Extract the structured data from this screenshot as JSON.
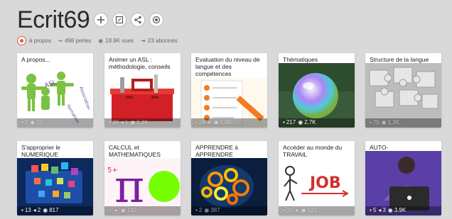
{
  "page": {
    "title": "Ecrit69",
    "buttons": [
      {
        "icon": "plus-icon"
      },
      {
        "icon": "edit-icon"
      },
      {
        "icon": "share-icon"
      },
      {
        "icon": "follow-icon"
      }
    ]
  },
  "stats": {
    "about": "à propos",
    "pearls": "498 perles",
    "views": "18.9K vues",
    "subscribers": "23 abonnés"
  },
  "cards": [
    {
      "title": "A propos...",
      "count": "2",
      "views": "37",
      "faint": true
    },
    {
      "title": "Animer un ASL : méthodologie, conseils",
      "count": "38",
      "likes": "1",
      "views": "1.3K",
      "faint": true
    },
    {
      "title": "Evaluation du niveau de langue et des compétences",
      "count": "26",
      "likes": "",
      "views": "1.3K",
      "faint": true
    },
    {
      "title": "Thématiques",
      "count": "217",
      "views": "2.7K",
      "faint": false
    },
    {
      "title": "Structure de la langue",
      "count": "70",
      "views": "1.3K",
      "faint": true
    },
    {
      "title": "S'approprier le NUMERIQUE",
      "count": "13",
      "likes": "2",
      "views": "817",
      "faint": false
    },
    {
      "title": "CALCUL et MATHEMATIQUES",
      "count": "",
      "likes": "",
      "views": "142",
      "faint": true
    },
    {
      "title": "APPRENDRE à APPRENDRE",
      "count": "2",
      "views": "387",
      "faint": true
    },
    {
      "title": "Accéder au monde du TRAVAIL",
      "count": "31",
      "likes": "",
      "views": "621",
      "faint": true
    },
    {
      "title": "AUTO-APPRENTISSAGE",
      "count": "5",
      "likes": "3",
      "views": "3.9K",
      "faint": false
    }
  ],
  "icons": {
    "pearls": "grid-icon",
    "views": "eye-icon",
    "subscribers": "subscribers-icon",
    "likes": "likes-icon"
  },
  "colors": {
    "background": "#d9d9d9",
    "card": "#ffffff",
    "accent": "#e05a3a"
  }
}
